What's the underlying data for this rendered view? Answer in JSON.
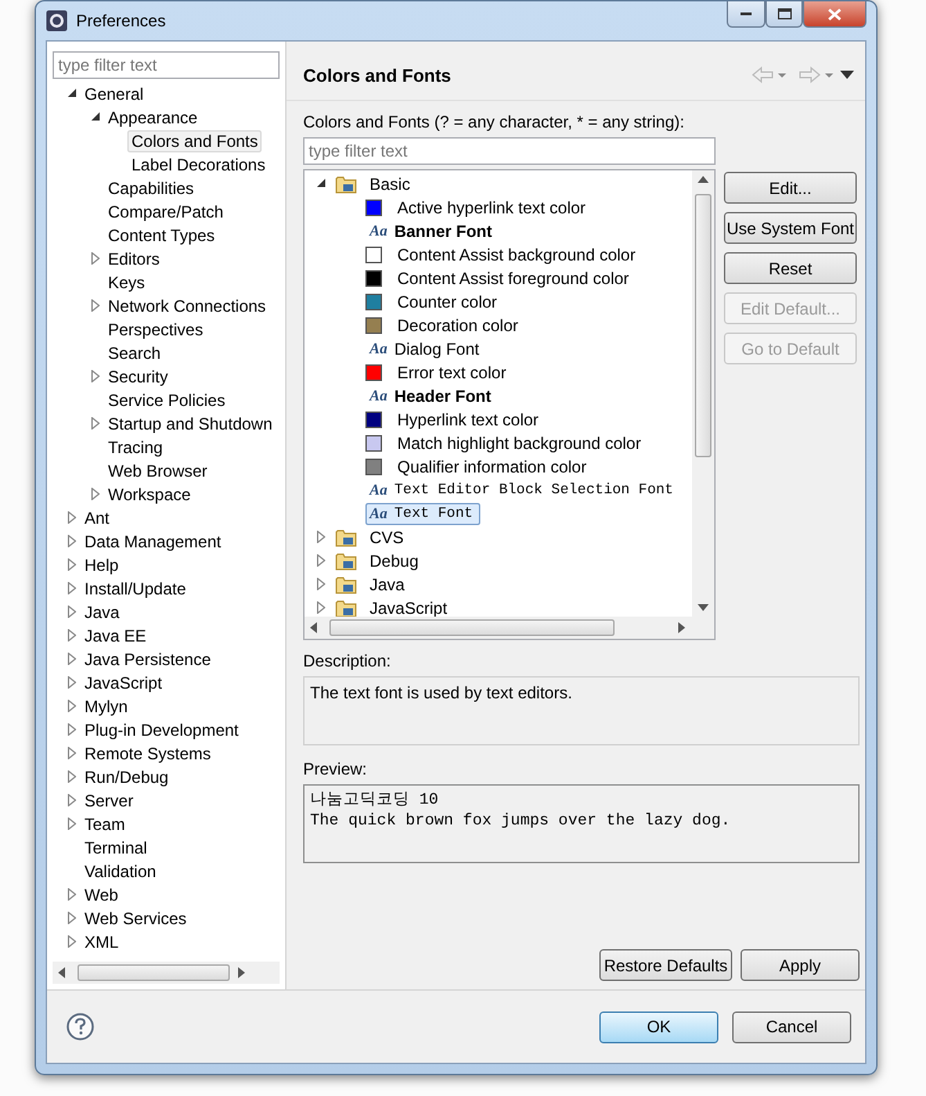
{
  "window": {
    "title": "Preferences"
  },
  "sidebar": {
    "filter": {
      "placeholder": "type filter text"
    },
    "tree": [
      {
        "kind": "branch",
        "label": "General",
        "expanded": true,
        "selected": false,
        "children": [
          {
            "kind": "branch",
            "label": "Appearance",
            "expanded": true,
            "selected": false,
            "children": [
              {
                "kind": "leaf",
                "label": "Colors and Fonts",
                "selected": true
              },
              {
                "kind": "leaf",
                "label": "Label Decorations",
                "selected": false
              }
            ]
          },
          {
            "kind": "leaf",
            "label": "Capabilities",
            "selected": false
          },
          {
            "kind": "leaf",
            "label": "Compare/Patch",
            "selected": false
          },
          {
            "kind": "leaf",
            "label": "Content Types",
            "selected": false
          },
          {
            "kind": "branch",
            "label": "Editors",
            "expanded": false,
            "selected": false
          },
          {
            "kind": "leaf",
            "label": "Keys",
            "selected": false
          },
          {
            "kind": "branch",
            "label": "Network Connections",
            "expanded": false,
            "selected": false
          },
          {
            "kind": "leaf",
            "label": "Perspectives",
            "selected": false
          },
          {
            "kind": "leaf",
            "label": "Search",
            "selected": false
          },
          {
            "kind": "branch",
            "label": "Security",
            "expanded": false,
            "selected": false
          },
          {
            "kind": "leaf",
            "label": "Service Policies",
            "selected": false
          },
          {
            "kind": "branch",
            "label": "Startup and Shutdown",
            "expanded": false,
            "selected": false
          },
          {
            "kind": "leaf",
            "label": "Tracing",
            "selected": false
          },
          {
            "kind": "leaf",
            "label": "Web Browser",
            "selected": false
          },
          {
            "kind": "branch",
            "label": "Workspace",
            "expanded": false,
            "selected": false
          }
        ]
      },
      {
        "kind": "branch",
        "label": "Ant",
        "expanded": false,
        "selected": false
      },
      {
        "kind": "branch",
        "label": "Data Management",
        "expanded": false,
        "selected": false
      },
      {
        "kind": "branch",
        "label": "Help",
        "expanded": false,
        "selected": false
      },
      {
        "kind": "branch",
        "label": "Install/Update",
        "expanded": false,
        "selected": false
      },
      {
        "kind": "branch",
        "label": "Java",
        "expanded": false,
        "selected": false
      },
      {
        "kind": "branch",
        "label": "Java EE",
        "expanded": false,
        "selected": false
      },
      {
        "kind": "branch",
        "label": "Java Persistence",
        "expanded": false,
        "selected": false
      },
      {
        "kind": "branch",
        "label": "JavaScript",
        "expanded": false,
        "selected": false
      },
      {
        "kind": "branch",
        "label": "Mylyn",
        "expanded": false,
        "selected": false
      },
      {
        "kind": "branch",
        "label": "Plug-in Development",
        "expanded": false,
        "selected": false
      },
      {
        "kind": "branch",
        "label": "Remote Systems",
        "expanded": false,
        "selected": false
      },
      {
        "kind": "branch",
        "label": "Run/Debug",
        "expanded": false,
        "selected": false
      },
      {
        "kind": "branch",
        "label": "Server",
        "expanded": false,
        "selected": false
      },
      {
        "kind": "branch",
        "label": "Team",
        "expanded": false,
        "selected": false
      },
      {
        "kind": "leaf",
        "label": "Terminal",
        "selected": false
      },
      {
        "kind": "leaf",
        "label": "Validation",
        "selected": false
      },
      {
        "kind": "branch",
        "label": "Web",
        "expanded": false,
        "selected": false
      },
      {
        "kind": "branch",
        "label": "Web Services",
        "expanded": false,
        "selected": false
      },
      {
        "kind": "branch",
        "label": "XML",
        "expanded": false,
        "selected": false
      }
    ]
  },
  "page": {
    "title": "Colors and Fonts",
    "filter_label": "Colors and Fonts (? = any character, * = any string):",
    "filter": {
      "placeholder": "type filter text"
    },
    "tree": [
      {
        "kind": "category",
        "label": "Basic",
        "expanded": true,
        "selected": false,
        "children": [
          {
            "kind": "color",
            "label": "Active hyperlink text color",
            "color": "#0000ff",
            "selected": false
          },
          {
            "kind": "boldfont",
            "icon": "Aa",
            "label": "Banner Font",
            "selected": false
          },
          {
            "kind": "color",
            "label": "Content Assist background color",
            "color": "#ffffff",
            "selected": false
          },
          {
            "kind": "color",
            "label": "Content Assist foreground color",
            "color": "#000000",
            "selected": false
          },
          {
            "kind": "color",
            "label": "Counter color",
            "color": "#1f7fa0",
            "selected": false
          },
          {
            "kind": "color",
            "label": "Decoration color",
            "color": "#957f50",
            "selected": false
          },
          {
            "kind": "font",
            "icon": "Aa",
            "label": "Dialog Font",
            "selected": false
          },
          {
            "kind": "color",
            "label": "Error text color",
            "color": "#ff0000",
            "selected": false
          },
          {
            "kind": "boldfont",
            "icon": "Aa",
            "label": "Header Font",
            "selected": false
          },
          {
            "kind": "color",
            "label": "Hyperlink text color",
            "color": "#000080",
            "selected": false
          },
          {
            "kind": "color",
            "label": "Match highlight background color",
            "color": "#c8c8f0",
            "selected": false
          },
          {
            "kind": "color",
            "label": "Qualifier information color",
            "color": "#808080",
            "selected": false
          },
          {
            "kind": "monofont",
            "icon": "Aa",
            "label": "Text Editor Block Selection Font",
            "selected": false
          },
          {
            "kind": "monofont",
            "icon": "Aa",
            "label": "Text Font",
            "selected": true
          }
        ]
      },
      {
        "kind": "category",
        "label": "CVS",
        "expanded": false,
        "selected": false
      },
      {
        "kind": "category",
        "label": "Debug",
        "expanded": false,
        "selected": false
      },
      {
        "kind": "category",
        "label": "Java",
        "expanded": false,
        "selected": false
      },
      {
        "kind": "category",
        "label": "JavaScript",
        "expanded": false,
        "selected": false
      }
    ],
    "side_buttons": [
      {
        "label": "Edit...",
        "disabled": false
      },
      {
        "label": "Use System Font",
        "disabled": false
      },
      {
        "label": "Reset",
        "disabled": false
      },
      {
        "label": "Edit Default...",
        "disabled": true
      },
      {
        "label": "Go to Default",
        "disabled": true
      }
    ],
    "description_label": "Description:",
    "description": "The text font is used by text editors.",
    "preview_label": "Preview:",
    "preview": [
      "나눔고딕코딩 10",
      "The quick brown fox jumps over the lazy dog."
    ],
    "buttons": [
      "Restore Defaults",
      "Apply"
    ]
  },
  "footer": {
    "buttons": [
      {
        "label": "OK",
        "default": true
      },
      {
        "label": "Cancel",
        "default": false
      }
    ]
  }
}
